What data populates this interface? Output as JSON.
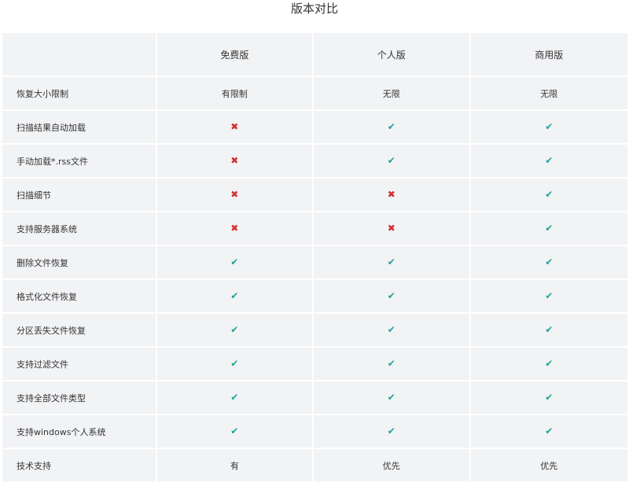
{
  "title": "版本对比",
  "colors": {
    "check": "#1aa39a",
    "cross": "#d3302f",
    "table_bg": "#f2f3f5"
  },
  "columns": [
    "",
    "免费版",
    "个人版",
    "商用版"
  ],
  "rows": [
    {
      "feature": "恢复大小限制",
      "values": [
        "有限制",
        "无限",
        "无限"
      ]
    },
    {
      "feature": "扫描结果自动加载",
      "values": [
        "no",
        "yes",
        "yes"
      ]
    },
    {
      "feature": "手动加载*.rss文件",
      "values": [
        "no",
        "yes",
        "yes"
      ]
    },
    {
      "feature": "扫描细节",
      "values": [
        "no",
        "no",
        "yes"
      ]
    },
    {
      "feature": "支持服务器系统",
      "values": [
        "no",
        "no",
        "yes"
      ]
    },
    {
      "feature": "删除文件恢复",
      "values": [
        "yes",
        "yes",
        "yes"
      ]
    },
    {
      "feature": "格式化文件恢复",
      "values": [
        "yes",
        "yes",
        "yes"
      ]
    },
    {
      "feature": "分区丢失文件恢复",
      "values": [
        "yes",
        "yes",
        "yes"
      ]
    },
    {
      "feature": "支持过滤文件",
      "values": [
        "yes",
        "yes",
        "yes"
      ]
    },
    {
      "feature": "支持全部文件类型",
      "values": [
        "yes",
        "yes",
        "yes"
      ]
    },
    {
      "feature": "支持windows个人系统",
      "values": [
        "yes",
        "yes",
        "yes"
      ]
    },
    {
      "feature": "技术支持",
      "values": [
        "有",
        "优先",
        "优先"
      ]
    }
  ],
  "icons": {
    "yes": "check-icon",
    "no": "cross-icon"
  },
  "glyphs": {
    "yes": "✔",
    "no": "✖"
  }
}
